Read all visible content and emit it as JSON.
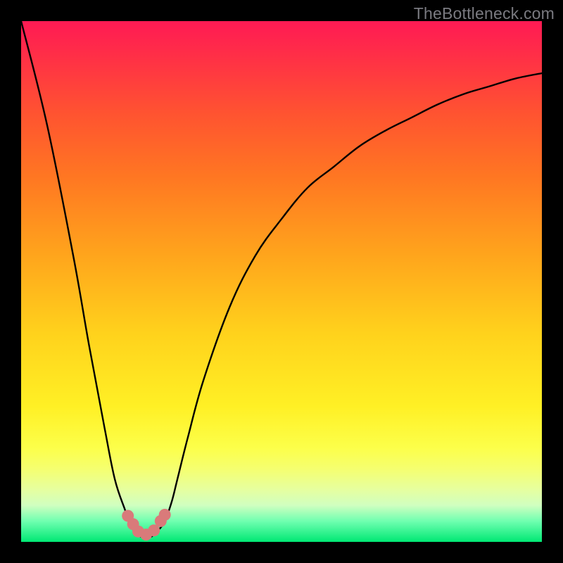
{
  "watermark": "TheBottleneck.com",
  "chart_data": {
    "type": "line",
    "title": "",
    "xlabel": "",
    "ylabel": "",
    "xlim": [
      0,
      100
    ],
    "ylim": [
      0,
      100
    ],
    "series": [
      {
        "name": "bottleneck-curve",
        "x": [
          0,
          5,
          10,
          13,
          16,
          18,
          20,
          21,
          22,
          23,
          24,
          25,
          26,
          27,
          28,
          29,
          30,
          32,
          35,
          40,
          45,
          50,
          55,
          60,
          65,
          70,
          75,
          80,
          85,
          90,
          95,
          100
        ],
        "values": [
          100,
          80,
          55,
          38,
          22,
          12,
          6,
          3,
          2,
          1,
          1,
          1,
          2,
          3,
          5,
          8,
          12,
          20,
          31,
          45,
          55,
          62,
          68,
          72,
          76,
          79,
          81.5,
          84,
          86,
          87.5,
          89,
          90
        ]
      }
    ],
    "markers": {
      "name": "highlight-dots",
      "color": "#d97a7a",
      "points_x": [
        20.5,
        21.5,
        22.5,
        24.0,
        25.5,
        26.8,
        27.6
      ],
      "points_y": [
        5.0,
        3.4,
        2.0,
        1.4,
        2.2,
        4.0,
        5.2
      ]
    },
    "gradient_stops": [
      {
        "pos": 0.0,
        "color": "#ff1a54"
      },
      {
        "pos": 0.18,
        "color": "#ff5430"
      },
      {
        "pos": 0.45,
        "color": "#ffa51c"
      },
      {
        "pos": 0.74,
        "color": "#fff025"
      },
      {
        "pos": 0.93,
        "color": "#d0ffc0"
      },
      {
        "pos": 1.0,
        "color": "#00e874"
      }
    ]
  }
}
